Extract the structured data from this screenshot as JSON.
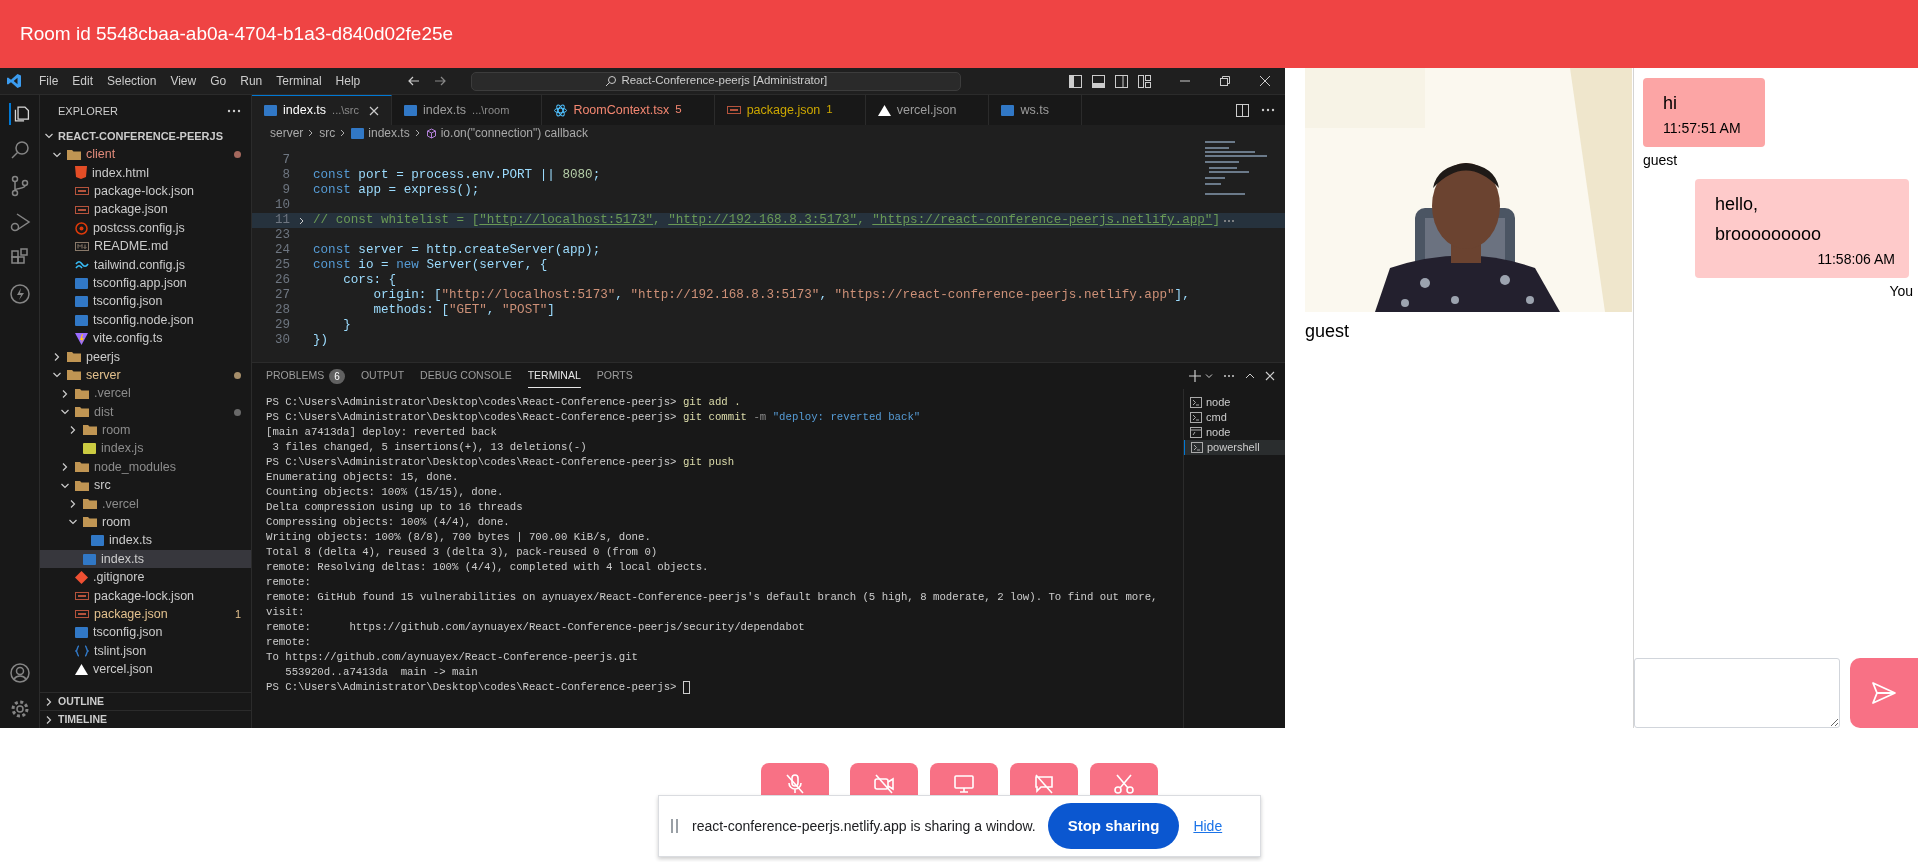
{
  "header": {
    "title": "Room id 5548cbaa-ab0a-4704-b1a3-d840d02fe25e"
  },
  "shared_screen": {
    "menu": [
      "File",
      "Edit",
      "Selection",
      "View",
      "Go",
      "Run",
      "Terminal",
      "Help"
    ],
    "command_center": "React-Conference-peerjs [Administrator]",
    "explorer": {
      "title": "EXPLORER",
      "root": "REACT-CONFERENCE-PEERJS",
      "tree": [
        {
          "name": "client",
          "kind": "folder",
          "expanded": true,
          "color": "#e08a7a",
          "selected": false,
          "children": [
            {
              "name": "index.html",
              "kind": "html",
              "selected": false
            },
            {
              "name": "package-lock.json",
              "kind": "json",
              "selected": false
            },
            {
              "name": "package.json",
              "kind": "json",
              "selected": false
            },
            {
              "name": "postcss.config.js",
              "kind": "postcss",
              "selected": false
            },
            {
              "name": "README.md",
              "kind": "md",
              "selected": false
            },
            {
              "name": "tailwind.config.js",
              "kind": "tailwind",
              "selected": false
            },
            {
              "name": "tsconfig.app.json",
              "kind": "ts",
              "selected": false
            },
            {
              "name": "tsconfig.json",
              "kind": "ts",
              "selected": false
            },
            {
              "name": "tsconfig.node.json",
              "kind": "ts",
              "selected": false
            },
            {
              "name": "vite.config.ts",
              "kind": "vite",
              "selected": false
            }
          ]
        },
        {
          "name": "peerjs",
          "kind": "folder",
          "expanded": false,
          "selected": false
        },
        {
          "name": "server",
          "kind": "folder",
          "expanded": true,
          "color": "#e2c08d",
          "selected": false,
          "children": [
            {
              "name": ".vercel",
              "kind": "folder",
              "expanded": false,
              "color": "#8c8c8c",
              "selected": false
            },
            {
              "name": "dist",
              "kind": "folder",
              "expanded": true,
              "color": "#8c8c8c",
              "selected": false,
              "children": [
                {
                  "name": "room",
                  "kind": "folder",
                  "expanded": false,
                  "color": "#8c8c8c",
                  "selected": false
                },
                {
                  "name": "index.js",
                  "kind": "js",
                  "color": "#8c8c8c",
                  "selected": false
                }
              ]
            },
            {
              "name": "node_modules",
              "kind": "folder",
              "expanded": false,
              "color": "#8c8c8c",
              "selected": false
            },
            {
              "name": "src",
              "kind": "folder",
              "expanded": true,
              "selected": false,
              "children": [
                {
                  "name": ".vercel",
                  "kind": "folder",
                  "expanded": false,
                  "color": "#8c8c8c",
                  "selected": false
                },
                {
                  "name": "room",
                  "kind": "folder",
                  "expanded": true,
                  "selected": false,
                  "children": [
                    {
                      "name": "index.ts",
                      "kind": "ts",
                      "selected": false
                    }
                  ]
                },
                {
                  "name": "index.ts",
                  "kind": "ts",
                  "selected": true
                }
              ]
            },
            {
              "name": ".gitignore",
              "kind": "git",
              "selected": false
            },
            {
              "name": "package-lock.json",
              "kind": "json",
              "selected": false
            },
            {
              "name": "package.json",
              "kind": "json",
              "color": "#e2c08d",
              "badge": "1",
              "selected": false
            },
            {
              "name": "tsconfig.json",
              "kind": "ts",
              "selected": false
            },
            {
              "name": "tslint.json",
              "kind": "tslint",
              "selected": false
            },
            {
              "name": "vercel.json",
              "kind": "vercel",
              "selected": false
            }
          ]
        }
      ],
      "sections": [
        "OUTLINE",
        "TIMELINE"
      ]
    },
    "tabs": [
      {
        "name": "index.ts",
        "hint": "...\\src",
        "kind": "ts",
        "selected": true
      },
      {
        "name": "index.ts",
        "hint": "...\\room",
        "kind": "ts",
        "selected": false
      },
      {
        "name": "RoomContext.tsx",
        "badge": "5",
        "kind": "react",
        "color": "#f48771",
        "selected": false
      },
      {
        "name": "package.json",
        "badge": "1",
        "kind": "json",
        "color": "#cca700",
        "selected": false
      },
      {
        "name": "vercel.json",
        "kind": "vercel",
        "selected": false
      },
      {
        "name": "ws.ts",
        "kind": "ts",
        "selected": false
      }
    ],
    "breadcrumb": [
      "server",
      "src",
      "index.ts",
      "io.on(\"connection\") callback"
    ],
    "code": [
      {
        "number": "7"
      },
      {
        "number": "8",
        "text": "const port = process.env.PORT || 8080;"
      },
      {
        "number": "9",
        "text": "const app = express();"
      },
      {
        "number": "10"
      },
      {
        "number": "11",
        "text": "// const whitelist = [\"http://localhost:5173\", \"http://192.168.8.3:5173\", \"https://react-conference-peerjs.netlify.app\"]",
        "kind": "comment",
        "folded": true
      },
      {
        "number": "23"
      },
      {
        "number": "24",
        "text": "const server = http.createServer(app);"
      },
      {
        "number": "25",
        "text": "const io = new Server(server, {"
      },
      {
        "number": "26",
        "text": "    cors: {"
      },
      {
        "number": "27",
        "text": "        origin: [\"http://localhost:5173\", \"http://192.168.8.3:5173\", \"https://react-conference-peerjs.netlify.app\"],"
      },
      {
        "number": "28",
        "text": "        methods: [\"GET\", \"POST\"]"
      },
      {
        "number": "29",
        "text": "    }"
      },
      {
        "number": "30",
        "text": "})"
      }
    ],
    "panel": {
      "tabs": [
        {
          "label": "PROBLEMS",
          "badge": "6",
          "selected": false
        },
        {
          "label": "OUTPUT",
          "selected": false
        },
        {
          "label": "DEBUG CONSOLE",
          "selected": false
        },
        {
          "label": "TERMINAL",
          "selected": true
        },
        {
          "label": "PORTS",
          "selected": false
        }
      ],
      "terminal_lines": [
        {
          "kind": "prompt",
          "path": "PS C:\\Users\\Administrator\\Desktop\\codes\\React-Conference-peerjs>",
          "command": "git add ."
        },
        {
          "kind": "prompt",
          "path": "PS C:\\Users\\Administrator\\Desktop\\codes\\React-Conference-peerjs>",
          "command": "git commit",
          "flag": "-m",
          "message": "\"deploy: reverted back\""
        },
        {
          "kind": "output",
          "text": "[main a7413da] deploy: reverted back"
        },
        {
          "kind": "output",
          "text": " 3 files changed, 5 insertions(+), 13 deletions(-)"
        },
        {
          "kind": "prompt",
          "path": "PS C:\\Users\\Administrator\\Desktop\\codes\\React-Conference-peerjs>",
          "command": "git push"
        },
        {
          "kind": "output",
          "text": "Enumerating objects: 15, done."
        },
        {
          "kind": "output",
          "text": "Counting objects: 100% (15/15), done."
        },
        {
          "kind": "output",
          "text": "Delta compression using up to 16 threads"
        },
        {
          "kind": "output",
          "text": "Compressing objects: 100% (4/4), done."
        },
        {
          "kind": "output",
          "text": "Writing objects: 100% (8/8), 700 bytes | 700.00 KiB/s, done."
        },
        {
          "kind": "output",
          "text": "Total 8 (delta 4), reused 3 (delta 3), pack-reused 0 (from 0)"
        },
        {
          "kind": "output",
          "text": "remote: Resolving deltas: 100% (4/4), completed with 4 local objects."
        },
        {
          "kind": "output",
          "text": "remote:"
        },
        {
          "kind": "output",
          "text": "remote: GitHub found 15 vulnerabilities on aynuayex/React-Conference-peerjs's default branch (5 high, 8 moderate, 2 low). To find out more,"
        },
        {
          "kind": "output",
          "text": "visit:"
        },
        {
          "kind": "output",
          "text": "remote:      https://github.com/aynuayex/React-Conference-peerjs/security/dependabot"
        },
        {
          "kind": "output",
          "text": "remote:"
        },
        {
          "kind": "output",
          "text": "To https://github.com/aynuayex/React-Conference-peerjs.git"
        },
        {
          "kind": "output",
          "text": "   553920d..a7413da  main -> main"
        },
        {
          "kind": "prompt",
          "path": "PS C:\\Users\\Administrator\\Desktop\\codes\\React-Conference-peerjs>",
          "cursor": true
        }
      ],
      "terminals": [
        {
          "name": "node",
          "kind": "powershell",
          "selected": false
        },
        {
          "name": "cmd",
          "kind": "powershell",
          "selected": false
        },
        {
          "name": "node",
          "kind": "cmd",
          "selected": false
        },
        {
          "name": "powershell",
          "kind": "powershell",
          "selected": true
        }
      ]
    }
  },
  "video": {
    "name": "guest"
  },
  "chat": {
    "messages": [
      {
        "text": "hi",
        "time": "11:57:51 AM",
        "sender": "guest",
        "own": false
      },
      {
        "text": "hello, brooooooooo",
        "time": "11:58:06 AM",
        "sender": "You",
        "own": true
      }
    ]
  },
  "controls": [
    {
      "kind": "mic_off"
    },
    {
      "kind": "camera_off"
    },
    {
      "kind": "screen"
    },
    {
      "kind": "chat_off"
    },
    {
      "kind": "hang_up"
    }
  ],
  "share_bar": {
    "message": "react-conference-peerjs.netlify.app is sharing a window.",
    "stop_button": "Stop sharing",
    "hide_link": "Hide"
  }
}
